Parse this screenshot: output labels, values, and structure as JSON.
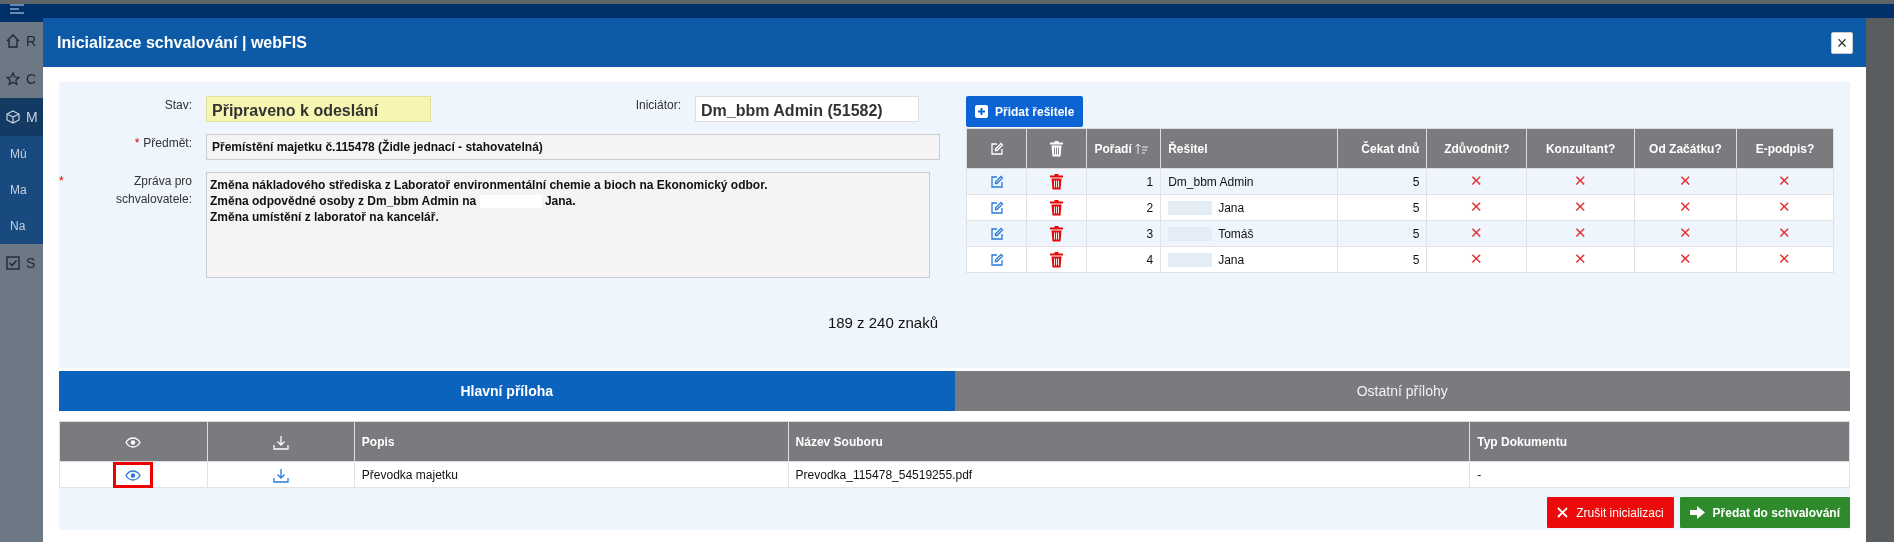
{
  "background": {
    "sidebar": [
      {
        "label": "R"
      },
      {
        "label": "C"
      },
      {
        "label": "M"
      },
      {
        "label": "Mú"
      },
      {
        "label": "Ma"
      },
      {
        "label": "Na"
      },
      {
        "label": "S"
      }
    ]
  },
  "modal": {
    "title": "Inicializace schvalování | webFIS",
    "close": "×"
  },
  "form": {
    "status_label": "Stav:",
    "status_value": "Připraveno k odeslání",
    "initiator_label": "Iniciátor:",
    "initiator_value": "Dm_bbm Admin (51582)",
    "subject_label": "Předmět:",
    "subject_mark": "*",
    "subject_value": "Přemístění majetku č.115478 (Židle jednací - stahovatelná)",
    "message_label": "Zpráva pro schvalovatele:",
    "message_mark": "*",
    "message_lines": [
      {
        "parts": [
          "Změna nákladového střediska z Laboratoř environmentální chemie a bioch na Ekonomický odbor."
        ]
      },
      {
        "parts": [
          "Změna odpovědné osoby z Dm_bbm Admin na",
          "Jana."
        ]
      },
      {
        "parts": [
          "Změna umístění z laboratoř na kancelář."
        ]
      }
    ],
    "char_count": "189 z 240 znaků"
  },
  "solvers": {
    "add_button": "Přidat řešitele",
    "columns": [
      "Pořadí",
      "Řešitel",
      "Čekat dnů",
      "Zdůvodnit?",
      "Konzultant?",
      "Od Začátku?",
      "E-podpis?"
    ],
    "rows": [
      {
        "order": "1",
        "name": "Dm_bbm Admin",
        "redacted": false,
        "days": "5",
        "flags": [
          "✕",
          "✕",
          "✕",
          "✕"
        ]
      },
      {
        "order": "2",
        "name": "Jana",
        "redacted": true,
        "days": "5",
        "flags": [
          "✕",
          "✕",
          "✕",
          "✕"
        ]
      },
      {
        "order": "3",
        "name": "Tomáš",
        "redacted": true,
        "days": "5",
        "flags": [
          "✕",
          "✕",
          "✕",
          "✕"
        ]
      },
      {
        "order": "4",
        "name": "Jana",
        "redacted": true,
        "days": "5",
        "flags": [
          "✕",
          "✕",
          "✕",
          "✕"
        ]
      }
    ]
  },
  "tabs": [
    {
      "label": "Hlavní příloha",
      "selected": true
    },
    {
      "label": "Ostatní přílohy",
      "selected": false
    }
  ],
  "attachments": {
    "columns": [
      "Popis",
      "Název Souboru",
      "Typ Dokumentu"
    ],
    "rows": [
      {
        "view_highlighted": true,
        "description": "Převodka majetku",
        "file": "Prevodka_115478_54519255.pdf",
        "type": "-"
      }
    ]
  },
  "buttons": [
    {
      "kind": "cancel",
      "label": "Zrušit inicializaci"
    },
    {
      "kind": "submit",
      "label": "Předat do schvalování"
    }
  ]
}
